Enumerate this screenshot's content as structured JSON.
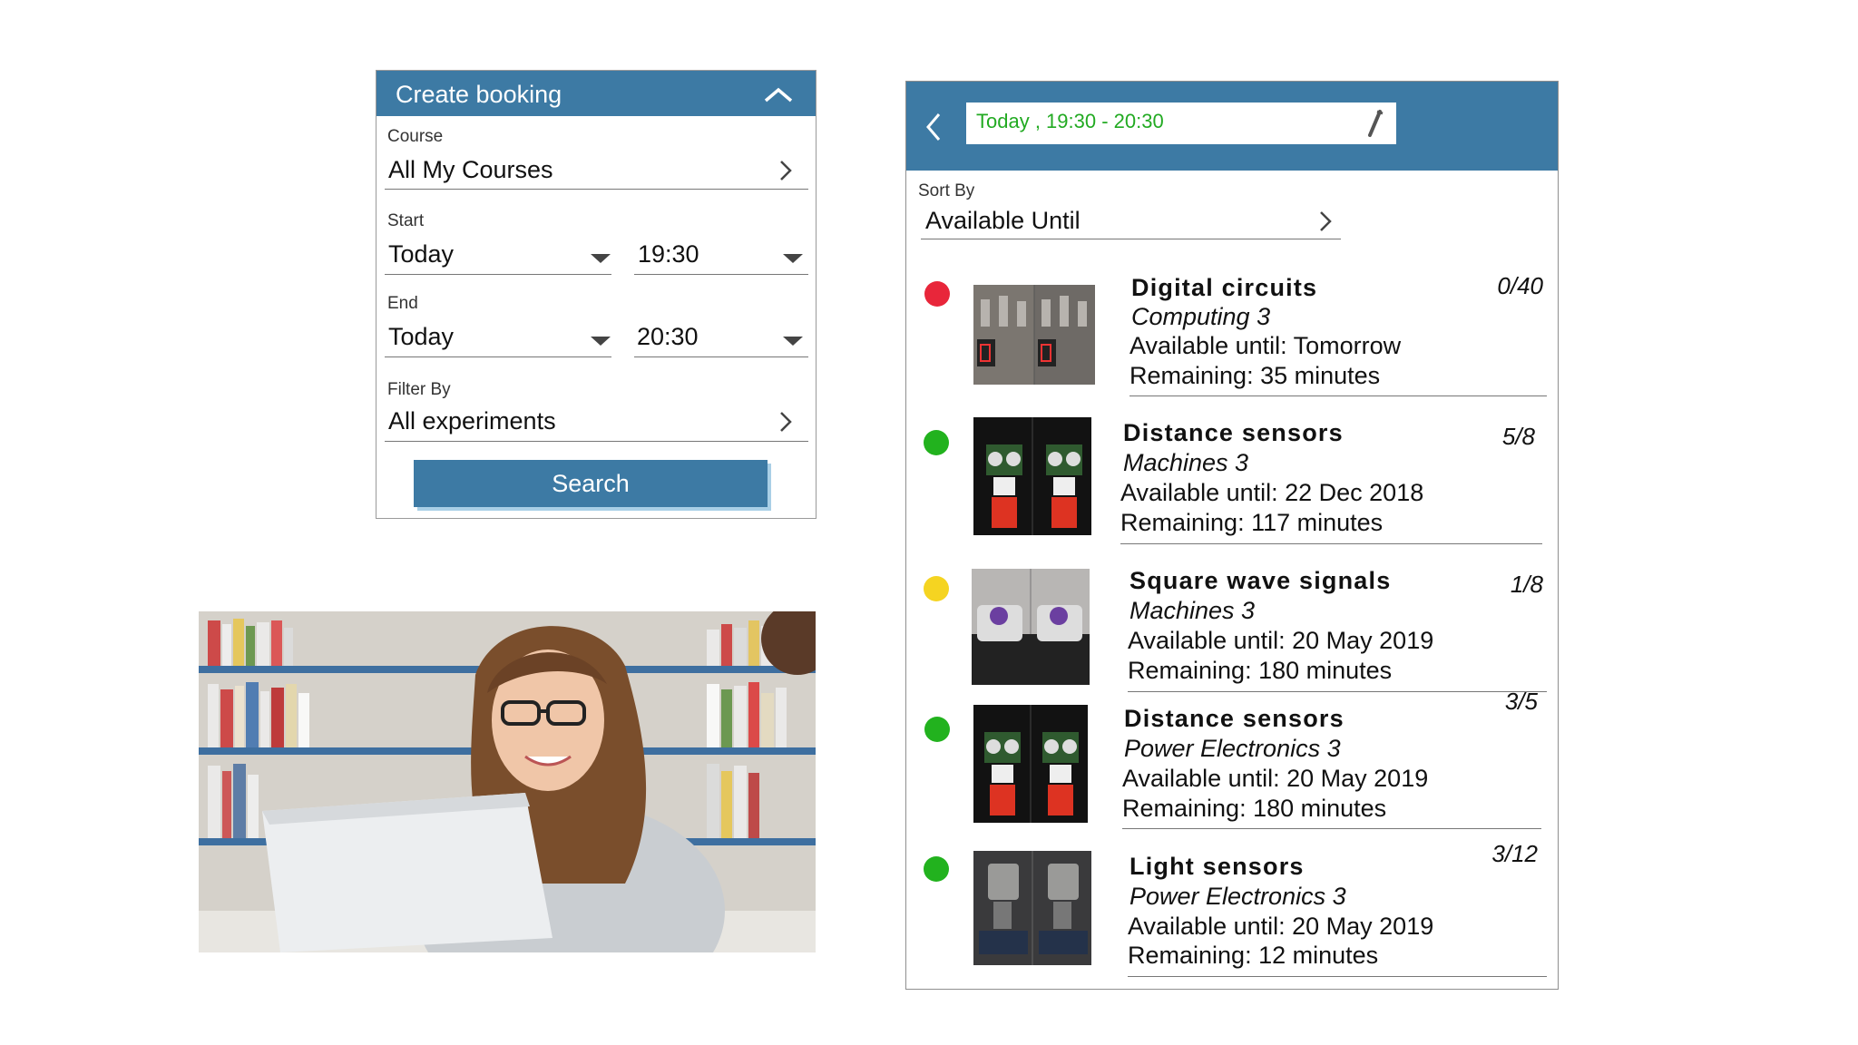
{
  "booking": {
    "title": "Create booking",
    "course_label": "Course",
    "course_value": "All My Courses",
    "start_label": "Start",
    "start_date": "Today",
    "start_time": "19:30",
    "end_label": "End",
    "end_date": "Today",
    "end_time": "20:30",
    "filter_label": "Filter By",
    "filter_value": "All experiments",
    "search_label": "Search"
  },
  "results": {
    "date_range": "Today , 19:30 - 20:30",
    "sort_label": "Sort By",
    "sort_value": "Available Until",
    "items": [
      {
        "name": "Digital circuits",
        "course": "Computing 3",
        "available": "Available until: Tomorrow",
        "remaining": "Remaining: 35 minutes",
        "count": "0/40",
        "status_color": "#e8263a"
      },
      {
        "name": "Distance sensors",
        "course": "Machines 3",
        "available": "Available until: 22 Dec 2018",
        "remaining": "Remaining: 117 minutes",
        "count": "5/8",
        "status_color": "#22b21e"
      },
      {
        "name": "Square wave signals",
        "course": "Machines 3",
        "available": "Available until: 20 May 2019",
        "remaining": "Remaining: 180 minutes",
        "count": "1/8",
        "status_color": "#f5d421"
      },
      {
        "name": "Distance sensors",
        "course": "Power Electronics 3",
        "available": "Available until: 20 May 2019",
        "remaining": "Remaining: 180 minutes",
        "count": "3/5",
        "status_color": "#22b21e"
      },
      {
        "name": "Light sensors",
        "course": "Power Electronics 3",
        "available": "Available until: 20 May 2019",
        "remaining": "Remaining: 12 minutes",
        "count": "3/12",
        "status_color": "#22b21e"
      }
    ]
  },
  "colors": {
    "accent": "#3d7aa4",
    "date_text": "#22aa22"
  }
}
